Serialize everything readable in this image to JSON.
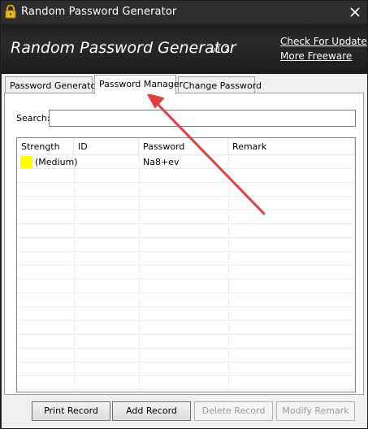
{
  "window": {
    "title": "Random Password Generator",
    "close_icon": "close-icon",
    "lock_icon": "lock-icon"
  },
  "header": {
    "app_title": "Random Password Generator",
    "version": "v1.3",
    "links": {
      "check_update": "Check For Update",
      "more_freeware": "More Freeware"
    }
  },
  "tabs": [
    {
      "label": "Password Generator",
      "active": false
    },
    {
      "label": "Password Manager",
      "active": true
    },
    {
      "label": "Change Password",
      "active": false
    }
  ],
  "search": {
    "label": "Search:",
    "value": "",
    "placeholder": ""
  },
  "table": {
    "columns": [
      "Strength",
      "ID",
      "Password",
      "Remark"
    ],
    "rows": [
      {
        "strength": "(Medium)",
        "strength_color": "#ffff00",
        "id": "",
        "password": "Na8+ev",
        "remark": ""
      }
    ]
  },
  "buttons": {
    "print": "Print Record",
    "add": "Add Record",
    "delete": "Delete Record",
    "modify": "Modify Remark"
  },
  "colors": {
    "header_bg": "#2a2a2a",
    "annotation_arrow": "#e04040",
    "medium_strength": "#ffff00"
  }
}
